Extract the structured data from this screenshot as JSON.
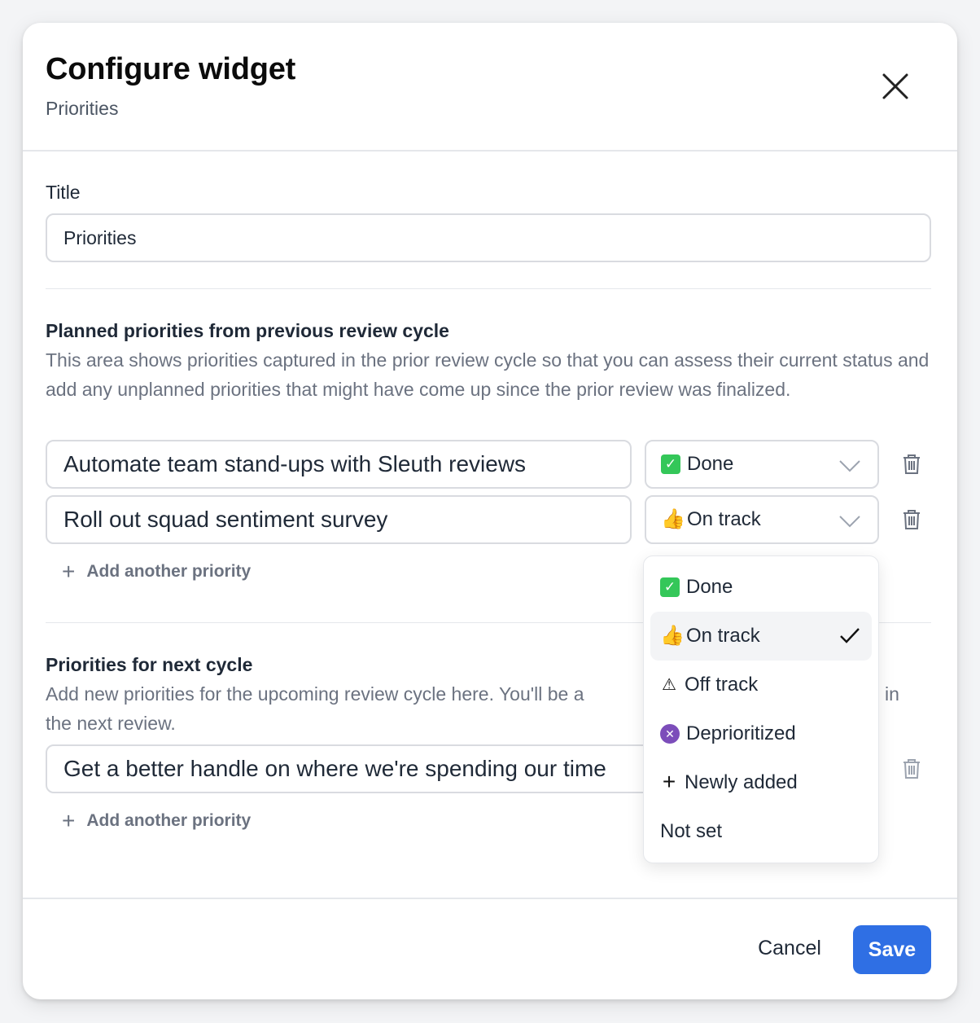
{
  "modal": {
    "title": "Configure widget",
    "subtitle": "Priorities"
  },
  "title_field": {
    "label": "Title",
    "value": "Priorities"
  },
  "planned": {
    "heading": "Planned priorities from previous review cycle",
    "description": "This area shows priorities captured in the prior review cycle so that you can assess their current status and add any unplanned priorities that might have come up since the prior review was finalized.",
    "items": [
      {
        "text": "Automate team stand-ups with Sleuth reviews",
        "status": "Done",
        "status_icon": "check-mark-icon"
      },
      {
        "text": "Roll out squad sentiment survey",
        "status": "On track",
        "status_icon": "thumbs-up-icon"
      }
    ],
    "add_label": "Add another priority"
  },
  "next": {
    "heading": "Priorities for next cycle",
    "description_visible_before": "Add new priorities for the upcoming review cycle here. You'll be a",
    "description_visible_after": "in",
    "description_line2": "the next review.",
    "items": [
      {
        "text": "Get a better handle on where we're spending our time"
      }
    ],
    "add_label": "Add another priority"
  },
  "status_menu": {
    "options": [
      {
        "label": "Done",
        "icon": "check-mark-icon"
      },
      {
        "label": "On track",
        "icon": "thumbs-up-icon",
        "selected": true
      },
      {
        "label": "Off track",
        "icon": "warning-icon"
      },
      {
        "label": "Deprioritized",
        "icon": "person-gesturing-no-icon"
      },
      {
        "label": "Newly added",
        "icon": "plus-icon"
      },
      {
        "label": "Not set",
        "icon": ""
      }
    ]
  },
  "footer": {
    "cancel_label": "Cancel",
    "save_label": "Save"
  },
  "colors": {
    "primary": "#2f6fe4",
    "border": "#d9dbe0",
    "muted_text": "#6b7280"
  }
}
